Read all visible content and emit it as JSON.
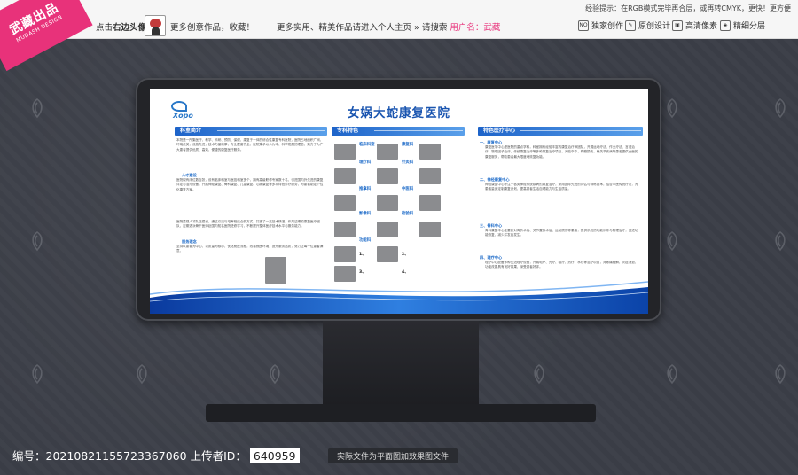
{
  "brand": {
    "name": "武藏出品",
    "sub": "MUDASH DESIGN"
  },
  "topbar": {
    "click_avatar_prefix": "点击",
    "click_avatar_bold": "右边头像",
    "more_works": "更多创意作品，收藏！",
    "more_practical": "更多实用、精美作品请进入个人主页 » 请搜索",
    "user_label": "用户名",
    "user_name": "武藏",
    "hint": "经验提示：在RGB模式完毕再合层，或再转CMYK，更快！更方便",
    "badges": [
      {
        "icon": "NO",
        "label": "独家创作"
      },
      {
        "icon": "✎",
        "label": "原创设计"
      },
      {
        "icon": "▣",
        "label": "高清像素"
      },
      {
        "icon": "◈",
        "label": "精细分层"
      }
    ]
  },
  "screen": {
    "logo_text": "Xopo",
    "title": "女娲大蛇康复医院",
    "sections": [
      {
        "label": "科室简介"
      },
      {
        "label": "专科特色"
      },
      {
        "label": "特色医疗中心"
      }
    ],
    "col1": {
      "paras": [
        "本院是一所集医疗、教学、科研、预防、保健、康复于一体的综合性康复专科医院，医院占地面积广阔，环境优美，设施先进，技术力量雄厚，专业配套齐全。医院秉承以人为本、科学发展的理念，致力于为广大患者提供优质、高效、便捷的康复医疗服务。",
        "医院现有床位数百张，设有临床科室与医技科室多个，拥有高级职称专家数十名，引进国内外先进的康复评定与治疗设备，开展神经康复、骨科康复、儿童康复、心肺康复等多项特色诊疗服务，为患者制定个性化康复方案。"
      ],
      "subs": [
        "人才建设",
        "服务理念"
      ],
      "paras2": [
        "医院重视人才队伍建设，通过引进与培养相结合的方式，打造了一支技术精湛、作风过硬的康复医疗团队，定期选派骨干医师赴国内知名医院进修学习，不断提升整体医疗技术水平与服务能力。",
        "坚持以患者为中心，以质量为核心，优化就医流程，改善就医环境，提升服务品质，努力让每一位患者满意。"
      ]
    },
    "col2": {
      "tags": [
        "临床科室",
        "康复科",
        "理疗科",
        "针灸科",
        "推拿科",
        "中医科",
        "影像科",
        "检验科",
        "功能科"
      ],
      "caption_nums": [
        "1、",
        "2、",
        "3、",
        "4、"
      ]
    },
    "col3": {
      "items": [
        {
          "heading": "一、康复中心",
          "text": "康复医学中心是医院的重点学科，科室拥有经验丰富的康复治疗师团队，开展运动疗法、作业疗法、言语治疗、物理因子治疗、传统康复治疗等多种康复治疗项目，为脑卒中、脊髓损伤、骨关节疾病等患者提供全面的康复服务，帮助患者最大限度地恢复功能。"
        },
        {
          "heading": "二、神经康复中心",
          "text": "神经康复中心专注于各类神经系统疾病的康复治疗，采用国际先进的评估与训练技术，结合中医传统疗法，为患者量身定制康复计划，提高患者生活自理能力与生活质量。"
        },
        {
          "heading": "三、骨科中心",
          "text": "骨科康复中心主要针对骨折术后、关节置换术后、运动损伤等患者，提供系统的功能训练与物理治疗，促进功能恢复，减少并发症发生。"
        },
        {
          "heading": "四、理疗中心",
          "text": "理疗中心配备多种先进理疗设备，开展电疗、光疗、磁疗、热疗、水疗等治疗项目，对疼痛缓解、炎症消退、功能改善具有良好效果，深受患者好评。"
        }
      ]
    }
  },
  "footer": {
    "id_label": "编号：",
    "id_value": "20210821155723367060",
    "uploader_label": "上传者ID：",
    "uploader_value": "640959",
    "notice": "实际文件为平面图加效果图文件"
  }
}
